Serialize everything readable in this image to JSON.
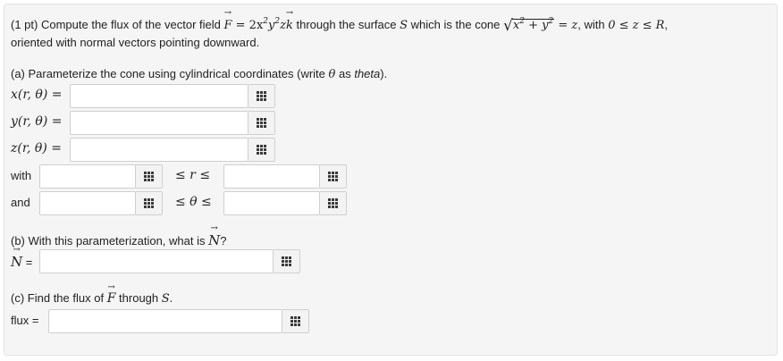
{
  "problem": {
    "points": "(1 pt)",
    "intro": "Compute the flux of the vector field",
    "field_symbol": "F",
    "field_expr_pre": " = 2x",
    "sup_x": "2",
    "field_y": "y",
    "sup_y": "2",
    "field_z": "z",
    "field_k": "k",
    "through_text": "through the surface",
    "surface_symbol": "S",
    "which_text": "which is the cone",
    "sqrt_inner_x": "x",
    "sqrt_sup_x": "2",
    "sqrt_plus": " + y",
    "sqrt_sup_y": "2",
    "cone_rest": " = z",
    "with_comma": ", with",
    "range": "0 ≤ z ≤ R",
    "end_comma": ",",
    "line2": "oriented with normal vectors pointing downward."
  },
  "part_a": {
    "label": "(a)",
    "text": "Parameterize the cone using cylindrical coordinates (write",
    "theta": "θ",
    "as_text": "as",
    "theta_word": "theta",
    "close": ").",
    "x_label": "x(r, θ) =",
    "y_label": "y(r, θ) =",
    "z_label": "z(r, θ) =",
    "with_label": "with",
    "and_label": "and",
    "r_ineq": "≤ r ≤",
    "theta_ineq": "≤ θ ≤"
  },
  "part_b": {
    "label": "(b)",
    "text": "With this parameterization, what is",
    "N_symbol": "N",
    "qmark": "?",
    "N_eq": "="
  },
  "part_c": {
    "label": "(c)",
    "text_pre": "Find the flux of",
    "F_symbol": "F",
    "text_mid": "through",
    "S_symbol": "S",
    "period": ".",
    "flux_label": "flux ="
  },
  "inputs": {
    "x_value": "",
    "y_value": "",
    "z_value": "",
    "r_lower": "",
    "r_upper": "",
    "theta_lower": "",
    "theta_upper": "",
    "normal_value": "",
    "flux_value": ""
  },
  "icons": {
    "equation_editor": "grid-icon"
  }
}
